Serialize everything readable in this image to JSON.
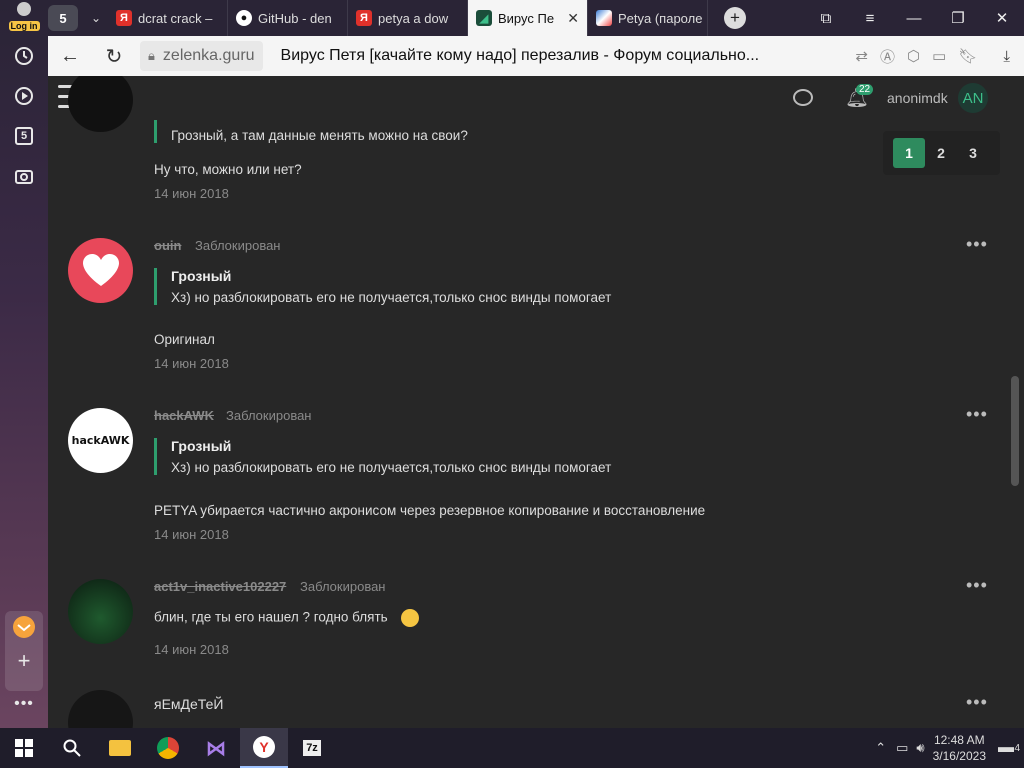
{
  "siderail": {
    "login_label": "Log in",
    "tab_count": "5"
  },
  "tabbar": {
    "tab_group_count": "5",
    "tabs": [
      {
        "label": "dcrat crack –",
        "favicon": "yandex-icon"
      },
      {
        "label": "GitHub - den",
        "favicon": "github-icon"
      },
      {
        "label": "petya a dow",
        "favicon": "yandex-icon"
      },
      {
        "label": "Вирус Пе",
        "favicon": "lolz-icon",
        "active": true
      },
      {
        "label": "Petya (пароле",
        "favicon": "petya-icon"
      }
    ]
  },
  "addrbar": {
    "domain": "zelenka.guru",
    "title": "Вирус Петя [качайте кому надо] перезалив - Форум социально..."
  },
  "header": {
    "notif_count": "22",
    "username": "anonimdk",
    "avatar_initials": "AN"
  },
  "pager": {
    "pages": [
      "1",
      "2",
      "3"
    ],
    "active": "1"
  },
  "posts": [
    {
      "quote_text": "Грозный, а там данные менять можно на свои?",
      "message": "Ну что, можно или нет?",
      "date": "14 июн 2018"
    },
    {
      "username": "ouin",
      "status": "Заблокирован",
      "quote_author": "Грозный",
      "quote_text": "Хз) но разблокировать его не получается,только снос винды помогает",
      "message": "Оригинал",
      "date": "14 июн 2018"
    },
    {
      "username": "hackAWK",
      "status": "Заблокирован",
      "avatar_text": "hackAWK",
      "quote_author": "Грозный",
      "quote_text": "Хз) но разблокировать его не получается,только снос винды помогает",
      "message": "PETYA убирается частично акронисом через резервное копирование и восстановление",
      "date": "14 июн 2018"
    },
    {
      "username": "act1v_inactive102227",
      "status": "Заблокирован",
      "message": "блин, где ты его нашел ? годно блять",
      "date": "14 июн 2018"
    },
    {
      "username": "яЕмДеТеЙ"
    }
  ],
  "taskbar": {
    "time": "12:48 AM",
    "date": "3/16/2023",
    "notif_count": "4"
  },
  "colors": {
    "accent": "#2e9e6e",
    "page_bg": "#272727",
    "heart_red": "#e8485a"
  }
}
